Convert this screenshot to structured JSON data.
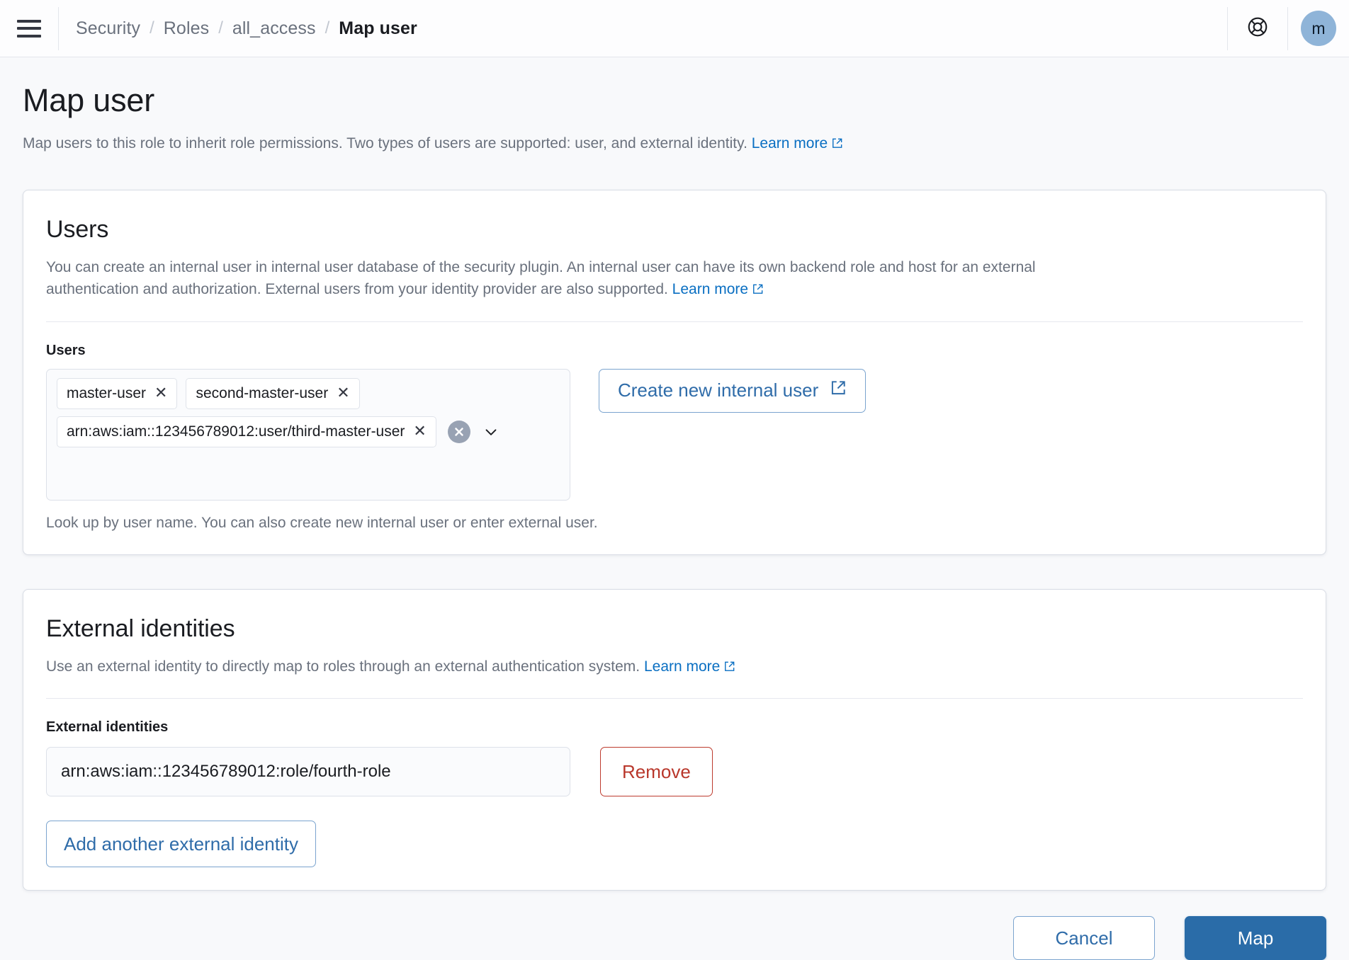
{
  "topnav": {
    "menu_icon": "hamburger-menu-icon",
    "breadcrumb": [
      {
        "label": "Security",
        "current": false
      },
      {
        "label": "Roles",
        "current": false
      },
      {
        "label": "all_access",
        "current": false
      },
      {
        "label": "Map user",
        "current": true
      }
    ],
    "separator": "/",
    "help_icon": "lifebuoy-help-icon",
    "avatar_initial": "m",
    "avatar_color": "#8fb4d8"
  },
  "page": {
    "title": "Map user",
    "description": "Map users to this role to inherit role permissions. Two types of users are supported: user, and external identity.",
    "learn_more": "Learn more"
  },
  "users_panel": {
    "title": "Users",
    "description": "You can create an internal user in internal user database of the security plugin. An internal user can have its own backend role and host for an external authentication and authorization. External users from your identity provider are also supported.",
    "learn_more": "Learn more",
    "field_label": "Users",
    "pills": [
      "master-user",
      "second-master-user",
      "arn:aws:iam::123456789012:user/third-master-user"
    ],
    "pill_remove_glyph": "✕",
    "clear_all_icon": "clear-all-circle-icon",
    "dropdown_icon": "chevron-down-icon",
    "help_text": "Look up by user name. You can also create new internal user or enter external user.",
    "create_user_button": "Create new internal user"
  },
  "external_panel": {
    "title": "External identities",
    "description": "Use an external identity to directly map to roles through an external authentication system.",
    "learn_more": "Learn more",
    "field_label": "External identities",
    "identity_value": "arn:aws:iam::123456789012:role/fourth-role",
    "identity_placeholder": "",
    "remove_button": "Remove",
    "add_button": "Add another external identity"
  },
  "footer": {
    "cancel_button": "Cancel",
    "map_button": "Map",
    "primary_color": "#2a6ca8",
    "danger_color": "#b9372b",
    "link_color": "#0a6fc2"
  }
}
